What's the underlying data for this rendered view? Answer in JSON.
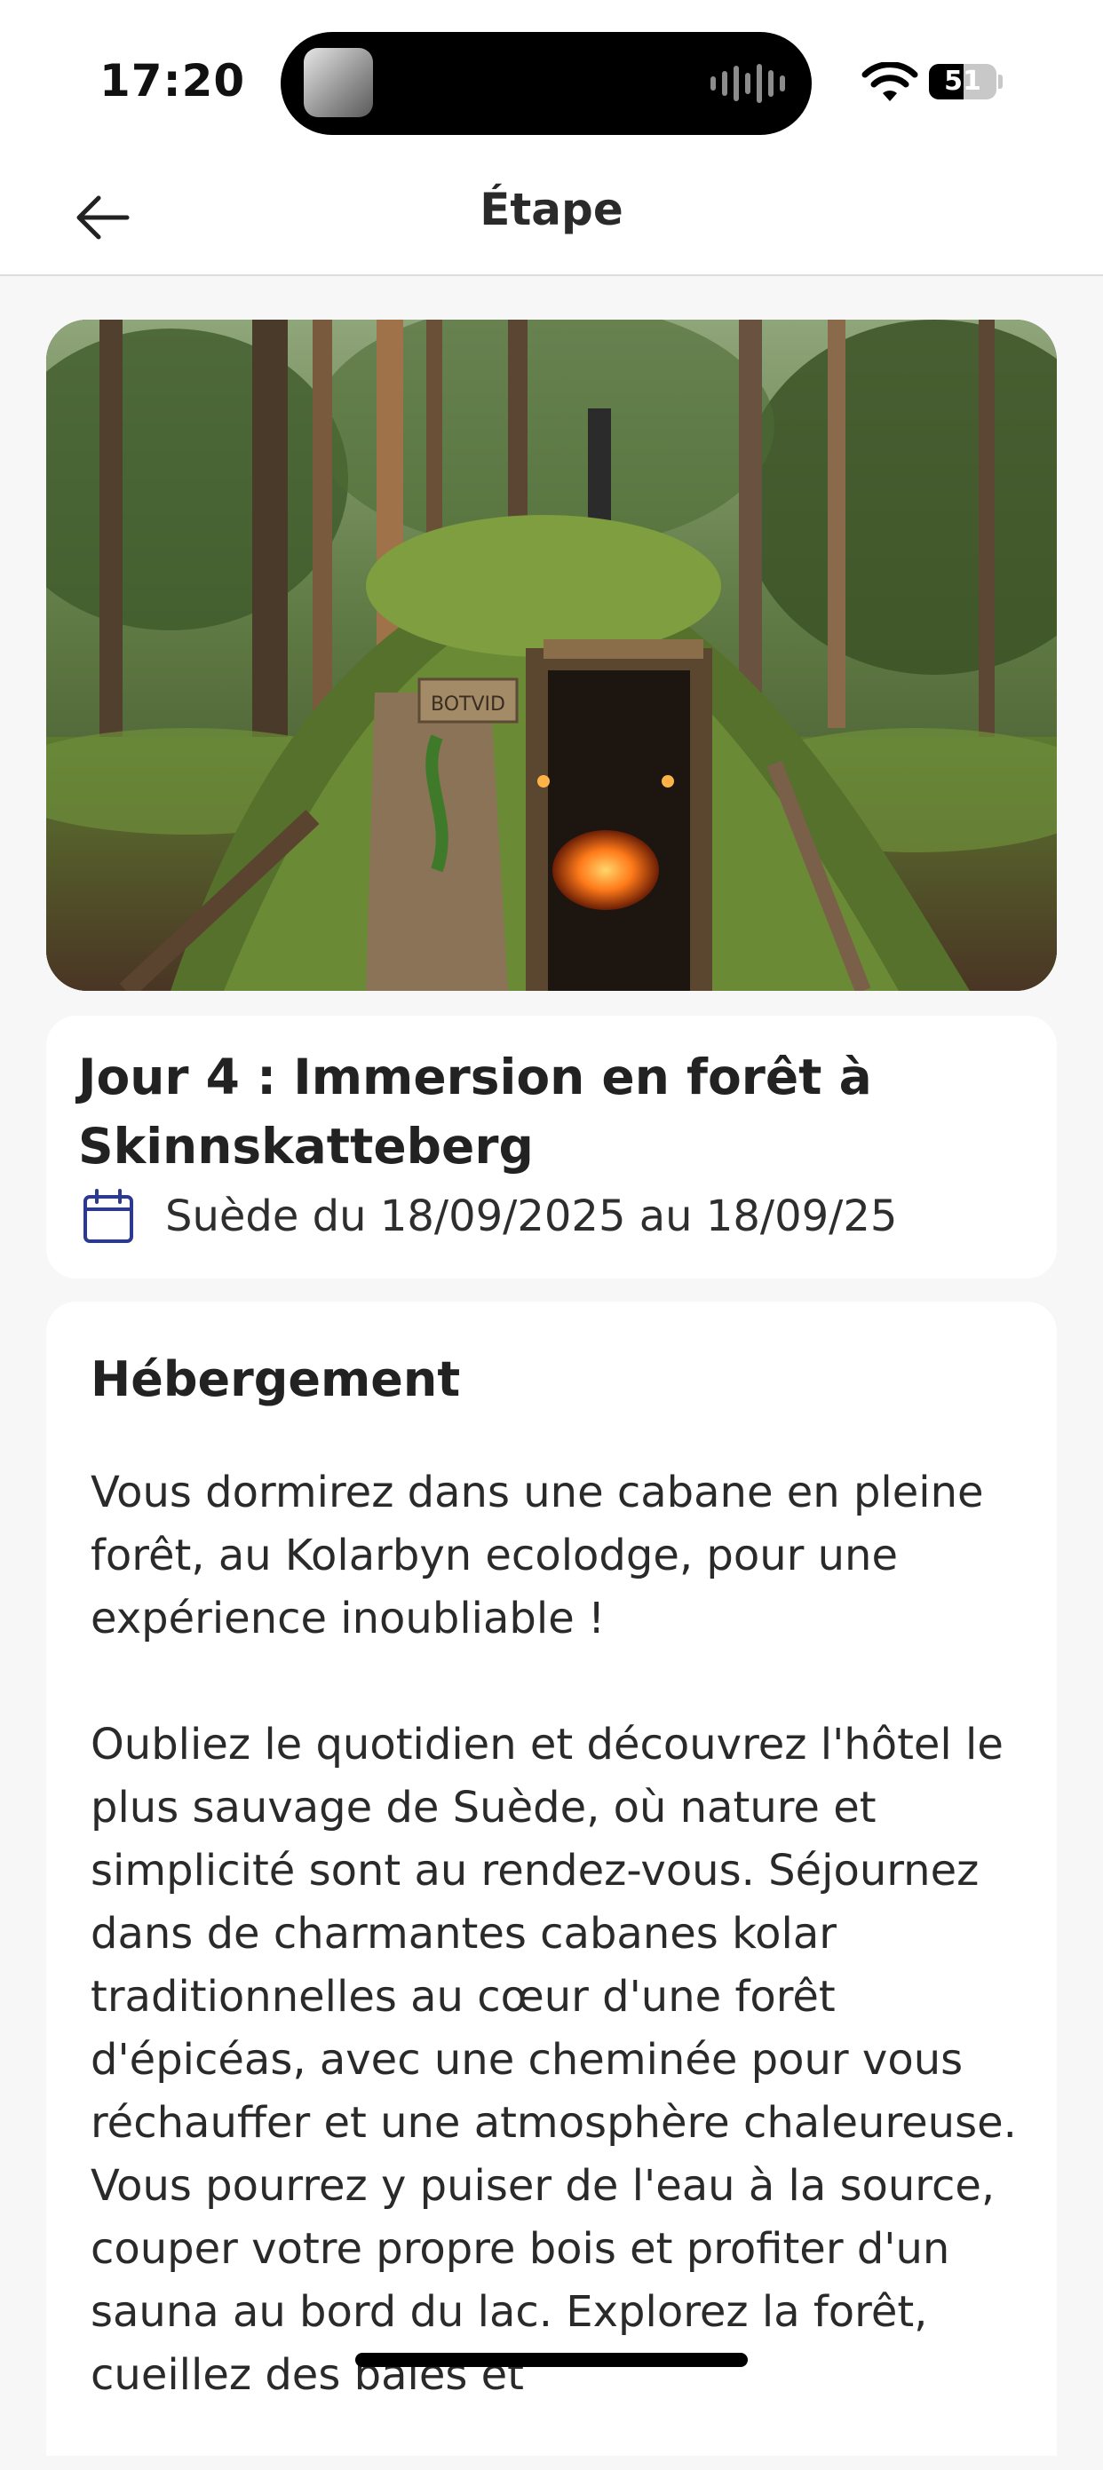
{
  "status_bar": {
    "time": "17:20",
    "battery_level": "51",
    "battery_fraction": 0.51
  },
  "header": {
    "title": "Étape",
    "back_icon": "arrow-left-icon"
  },
  "hero": {
    "sign_text": "BOTVID"
  },
  "step": {
    "title": "Jour 4 : Immersion en forêt à Skinnskatteberg",
    "date_line": "Suède du 18/09/2025 au 18/09/25",
    "date_icon": "calendar-icon"
  },
  "accommodation": {
    "heading": "Hébergement",
    "paragraph_1": "Vous dormirez dans une cabane en pleine forêt, au Kolarbyn ecolodge, pour une expérience inoubliable !",
    "paragraph_2": "Oubliez le quotidien et découvrez l'hôtel le plus sauvage de Suède, où nature et simplicité sont au rendez-vous. Séjournez dans de charmantes cabanes kolar traditionnelles au cœur d'une forêt d'épicéas, avec une cheminée pour vous réchauffer et une atmosphère chaleureuse. Vous pourrez y puiser de l'eau à la source, couper votre propre bois et profiter d'un sauna au bord du lac. Explorez la forêt, cueillez des baies et"
  },
  "colors": {
    "accent_blue": "#2b3a8f",
    "background": "#f7f7f8",
    "card": "#ffffff"
  }
}
